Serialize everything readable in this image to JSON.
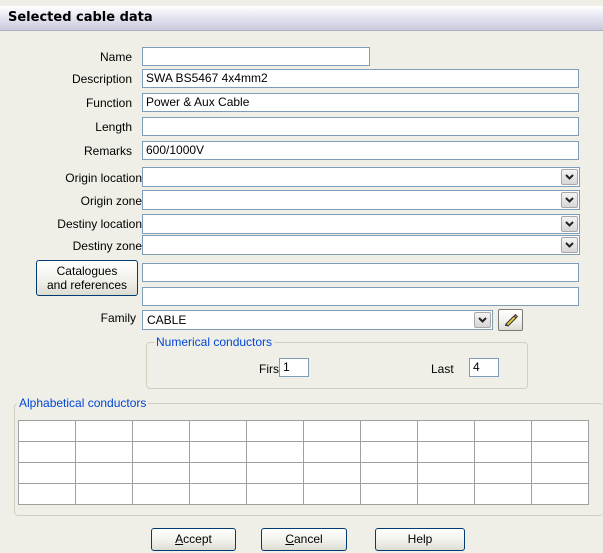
{
  "window": {
    "title": "Selected cable data"
  },
  "fields": {
    "name": {
      "label": "Name",
      "value": ""
    },
    "description": {
      "label": "Description",
      "value": "SWA BS5467 4x4mm2"
    },
    "function": {
      "label": "Function",
      "value": "Power & Aux Cable"
    },
    "length": {
      "label": "Length",
      "value": ""
    },
    "remarks": {
      "label": "Remarks",
      "value": "600/1000V"
    }
  },
  "locations": {
    "origin_location": {
      "label": "Origin location",
      "value": ""
    },
    "origin_zone": {
      "label": "Origin zone",
      "value": ""
    },
    "destiny_location": {
      "label": "Destiny location",
      "value": ""
    },
    "destiny_zone": {
      "label": "Destiny zone",
      "value": ""
    }
  },
  "catalogues": {
    "button_line1": "Catalogues",
    "button_line2": "and references",
    "value1": "",
    "value2": ""
  },
  "family": {
    "label": "Family",
    "value": "CABLE",
    "edit_icon": "pencil-icon"
  },
  "numerical_conductors": {
    "legend": "Numerical conductors",
    "first_label": "First",
    "first_value": "1",
    "last_label": "Last",
    "last_value": "4"
  },
  "alphabetical_conductors": {
    "legend": "Alphabetical conductors",
    "rows": 4,
    "cols": 10
  },
  "buttons": {
    "accept_hotkey": "A",
    "accept_rest": "ccept",
    "cancel_hotkey": "C",
    "cancel_rest": "ancel",
    "help": "Help"
  },
  "colors": {
    "dialog_bg": "#efefe8",
    "field_border": "#7f9db9",
    "legend_text": "#0046d5",
    "button_border": "#003c74"
  }
}
